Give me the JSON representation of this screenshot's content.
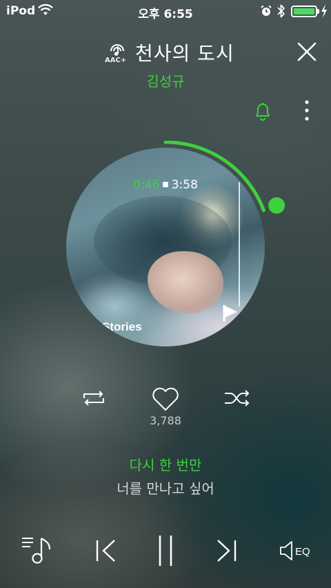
{
  "status_bar": {
    "carrier": "iPod",
    "time": "오후 6:55",
    "battery_color": "#4cd964"
  },
  "header": {
    "quality_badge": "AAC+",
    "title": "천사의 도시",
    "artist": "김성규"
  },
  "player": {
    "elapsed": "0:46",
    "total": "3:58",
    "progress_fraction": 0.193,
    "album_text": "Stories",
    "likes": "3,788"
  },
  "lyrics": {
    "current": "다시 한 번만",
    "next": "너를 만나고 싶어"
  },
  "controls": {
    "eq_label": "EQ"
  },
  "colors": {
    "accent": "#3dd13d",
    "text": "#ffffff",
    "muted": "#c9cccc"
  },
  "icons": [
    "wifi-icon",
    "alarm-icon",
    "bluetooth-icon",
    "battery-icon",
    "charging-icon",
    "aac-icon",
    "close-icon",
    "bell-icon",
    "more-icon",
    "repeat-icon",
    "heart-icon",
    "shuffle-icon",
    "playlist-icon",
    "previous-icon",
    "pause-icon",
    "next-icon",
    "eq-icon"
  ]
}
